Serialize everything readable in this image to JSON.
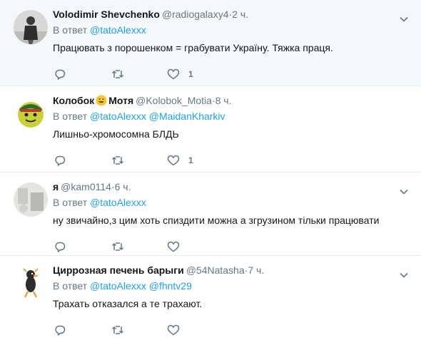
{
  "tweets": [
    {
      "name": "Volodimir Shevchenko",
      "handle": "@radiogalaxy4",
      "time": "2 ч.",
      "reply_prefix": "В ответ",
      "mentions": [
        "@tatoAlexxx"
      ],
      "text": "Працювать з порошенком = грабувати Україну. Тяжка праця.",
      "likes": "1",
      "avatar_icon": "person-photo-avatar"
    },
    {
      "name": "Колобок",
      "name_suffix": "Мотя",
      "emoji_icon": "grinning-face-emoji",
      "handle": "@Kolobok_Motia",
      "time": "8 ч.",
      "reply_prefix": "В ответ",
      "mentions": [
        "@tatoAlexxx",
        "@MaidanKharkiv"
      ],
      "text": "Лишньо-хромосомна БЛДЬ",
      "likes": "1",
      "avatar_icon": "kolobok-avatar"
    },
    {
      "name": "я",
      "handle": "@kam0114",
      "time": "6 ч.",
      "reply_prefix": "В ответ",
      "mentions": [
        "@tatoAlexxx"
      ],
      "text": "ну звичайно,з цим хоть спиздити можна а згрузином тільки працювати",
      "likes": "",
      "avatar_icon": "photo-avatar"
    },
    {
      "name": "Циррозная печень барыги",
      "handle": "@54Natasha",
      "time": "7 ч.",
      "reply_prefix": "В ответ",
      "mentions": [
        "@tatoAlexxx",
        "@fhntv29"
      ],
      "text": "Трахать отказался а те трахают.",
      "likes": "",
      "avatar_icon": "cartoon-bird-avatar"
    }
  ],
  "separator": "·",
  "colors": {
    "link": "#1da1f2",
    "secondary": "#657786",
    "text": "#14171a",
    "border": "#e6ecf0",
    "hover_bg": "#f5f8fa"
  }
}
